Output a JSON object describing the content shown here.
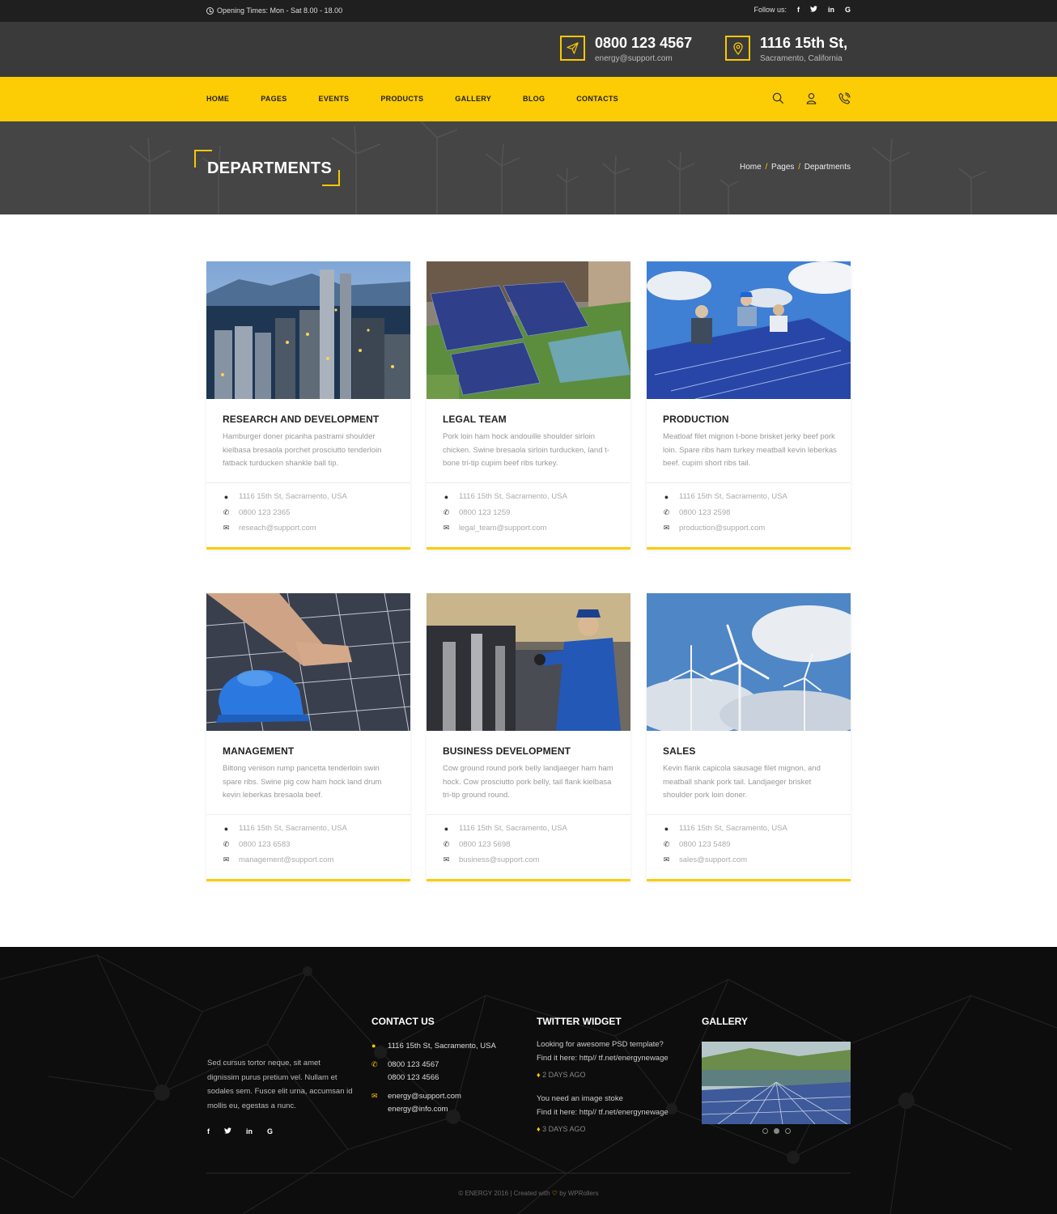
{
  "topbar": {
    "opening": "Opening Times: Mon - Sat 8.00 - 18.00",
    "follow_label": "Follow us:",
    "socials": [
      "f",
      "t",
      "in",
      "G"
    ]
  },
  "header": {
    "phone": "0800 123 4567",
    "email": "energy@support.com",
    "address": "1116 15th St,",
    "city": "Sacramento, California"
  },
  "nav": {
    "items": [
      "HOME",
      "PAGES",
      "EVENTS",
      "PRODUCTS",
      "GALLERY",
      "BLOG",
      "CONTACTS"
    ],
    "icons": [
      "search-icon",
      "user-icon",
      "phone-icon"
    ]
  },
  "banner": {
    "title": "DEPARTMENTS",
    "breadcrumb": [
      "Home",
      "Pages",
      "Departments"
    ],
    "separator": "/"
  },
  "cards": [
    {
      "title": "RESEARCH AND DEVELOPMENT",
      "desc": "Hamburger doner picanha pastrami shoulder kielbasa bresaola porchet prosciutto tenderloin fatback turducken shankle ball tip.",
      "address": "1116 15th St, Sacramento, USA",
      "phone": "0800 123 2365",
      "email": "reseach@support.com"
    },
    {
      "title": "LEGAL TEAM",
      "desc": "Pork loin ham hock andouille shoulder sirloin chicken. Swine bresaola sirloin turducken, land t-bone tri-tip cupim beef ribs turkey.",
      "address": "1116 15th St, Sacramento, USA",
      "phone": "0800 123 1259",
      "email": "legal_team@support.com"
    },
    {
      "title": "PRODUCTION",
      "desc": "Meatloaf filet mignon t-bone brisket jerky beef pork loin. Spare ribs ham turkey meatball kevin leberkas beef. cupim short ribs tail.",
      "address": "1116 15th St, Sacramento, USA",
      "phone": "0800 123 2598",
      "email": "production@support.com"
    },
    {
      "title": "MANAGEMENT",
      "desc": "Biltong venison rump pancetta tenderloin swin spare ribs. Swine pig cow ham hock land drum kevin leberkas bresaola beef.",
      "address": "1116 15th St, Sacramento, USA",
      "phone": "0800 123 6583",
      "email": "management@support.com"
    },
    {
      "title": "BUSINESS DEVELOPMENT",
      "desc": "Cow ground round pork belly landjaeger ham ham hock. Cow prosciutto pork belly, tail flank kielbasa tri-tip ground round.",
      "address": "1116 15th St, Sacramento, USA",
      "phone": "0800 123 5698",
      "email": "business@support.com"
    },
    {
      "title": "SALES",
      "desc": "Kevin flank capicola sausage filet mignon, and meatball shank pork tail. Landjaeger brisket shoulder pork loin doner.",
      "address": "1116 15th St, Sacramento, USA",
      "phone": "0800 123 5489",
      "email": "sales@support.com"
    }
  ],
  "footer": {
    "about": "Sed cursus tortor neque, sit amet dignissim purus pretium vel. Nullam et sodales sem. Fusce elit urna, accumsan id mollis eu, egestas a nunc.",
    "socials": [
      "f",
      "t",
      "in",
      "G"
    ],
    "contact_title": "CONTACT US",
    "contact_address": "1116 15th St, Sacramento, USA",
    "contact_phone1": "0800 123 4567",
    "contact_phone2": "0800 123 4566",
    "contact_email1": "energy@support.com",
    "contact_email2": "energy@info.com",
    "twitter_title": "TWITTER WIDGET",
    "tweets": [
      {
        "line1": "Looking for awesome PSD template?",
        "line2": "Find it here: http// tf.net/energynewage",
        "ago": "2 DAYS AGO"
      },
      {
        "line1": "You need an image stoke",
        "line2": "Find it here: http// tf.net/energynewage",
        "ago": "3 DAYS AGO"
      }
    ],
    "gallery_title": "GALLERY",
    "copyright_left": "© ENERGY 2016 | Created with",
    "copyright_right": "by WPRollers"
  },
  "colors": {
    "accent": "#fccc04",
    "dark": "#3a3a3a",
    "footer": "#0d0d0d"
  }
}
